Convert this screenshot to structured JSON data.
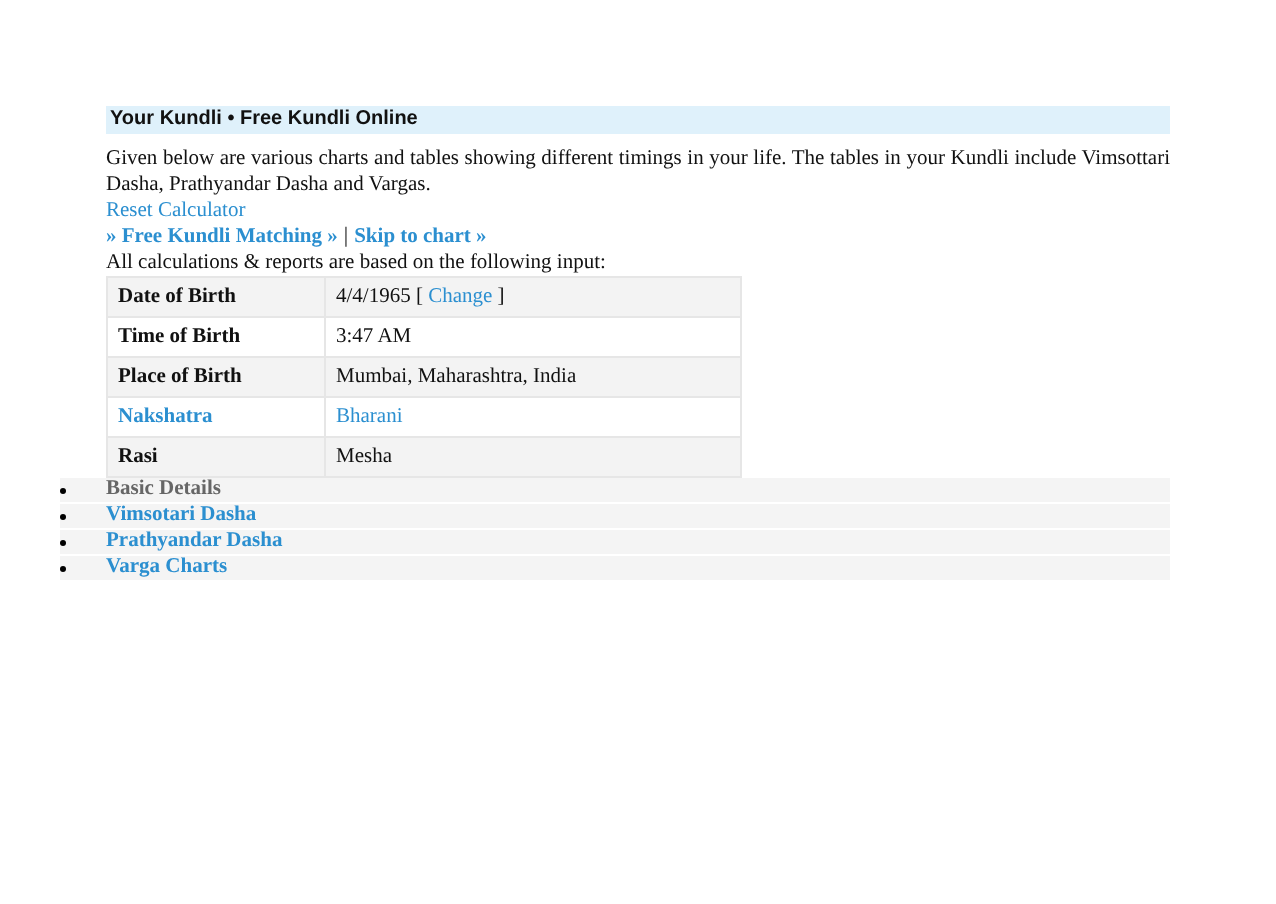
{
  "header": {
    "title": "Your Kundli • Free Kundli Online"
  },
  "intro": "Given below are various charts and tables showing different timings in your life. The tables in your Kundli include Vimsottari Dasha, Prathyandar Dasha and Vargas.",
  "reset_link": "Reset Calculator",
  "links": [
    {
      "text": "» Free Kundli Matching »"
    },
    {
      "text": "Skip to chart »"
    }
  ],
  "link_separator": "|",
  "input_note": "All calculations & reports are based on the following input:",
  "details": [
    {
      "label": "Date of Birth",
      "value": "4/4/1965 [",
      "action": "Change",
      "value_end": "]",
      "link": false
    },
    {
      "label": "Time of Birth",
      "value": "3:47 AM",
      "link": false
    },
    {
      "label": "Place of Birth",
      "value": "Mumbai, Maharashtra, India",
      "link": false
    },
    {
      "label": "Nakshatra",
      "value": "Bharani",
      "link": true
    },
    {
      "label": "Rasi",
      "value": "Mesha",
      "link": false
    }
  ],
  "sections": [
    {
      "label": "Basic Details",
      "selected": true
    },
    {
      "label": "Vimsotari Dasha",
      "selected": false
    },
    {
      "label": "Prathyandar Dasha",
      "selected": false
    },
    {
      "label": "Varga Charts",
      "selected": false
    }
  ]
}
